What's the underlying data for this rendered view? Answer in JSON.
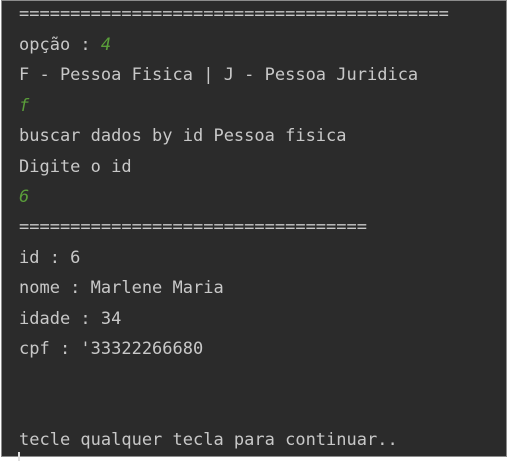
{
  "console": {
    "separator_long": "==========================================",
    "option_label": "opção : ",
    "option_value": "4",
    "person_type_prompt": "F - Pessoa Fisica | J - Pessoa Juridica",
    "person_type_input": "f",
    "search_message": "buscar dados by id Pessoa fisica",
    "id_prompt": "Digite o id",
    "id_input": "6",
    "separator_short": "==================================",
    "result_id": "id : 6",
    "result_name": "nome : Marlene Maria",
    "result_age": "idade : 34",
    "result_cpf": "cpf : '33322266680",
    "continue_prompt": "tecle qualquer tecla para continuar.."
  },
  "colors": {
    "background": "#2b2b2b",
    "text": "#c8c8c8",
    "user_input": "#5a9e3a"
  }
}
